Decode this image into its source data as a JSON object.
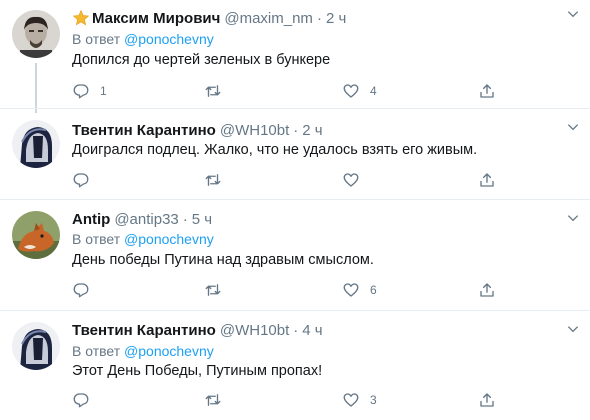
{
  "tweets": [
    {
      "name": "Максим Мирович",
      "handle": "@maxim_nm",
      "time": "2 ч",
      "reply_prefix": "В ответ",
      "reply_to": "@ponochevny",
      "text": "Допился до чертей зеленых в бункере",
      "reply_count": "1",
      "retweet_count": "",
      "like_count": "4"
    },
    {
      "name": "Твентин Карантино",
      "handle": "@WH10bt",
      "time": "2 ч",
      "text": "Доигрался подлец. Жалко, что не удалось взять его живым.",
      "reply_count": "",
      "retweet_count": "",
      "like_count": ""
    },
    {
      "name": "Antip",
      "handle": "@antip33",
      "time": "5 ч",
      "reply_prefix": "В ответ",
      "reply_to": "@ponochevny",
      "text": "День победы Путина над здравым смыслом.",
      "reply_count": "",
      "retweet_count": "",
      "like_count": "6"
    },
    {
      "name": "Твентин Карантино",
      "handle": "@WH10bt",
      "time": "4 ч",
      "reply_prefix": "В ответ",
      "reply_to": "@ponochevny",
      "text": "Этот День Победы, Путиным пропах!",
      "reply_count": "",
      "retweet_count": "",
      "like_count": "3"
    }
  ],
  "icons": {
    "reply": "reply-icon",
    "retweet": "retweet-icon",
    "like": "heart-icon",
    "share": "share-icon",
    "more": "chevron-down-icon",
    "star": "star-emoji-icon"
  },
  "colors": {
    "link": "#1da1f2",
    "muted": "#657786",
    "divider": "#e6ecf0",
    "star": "#f5b82e"
  }
}
